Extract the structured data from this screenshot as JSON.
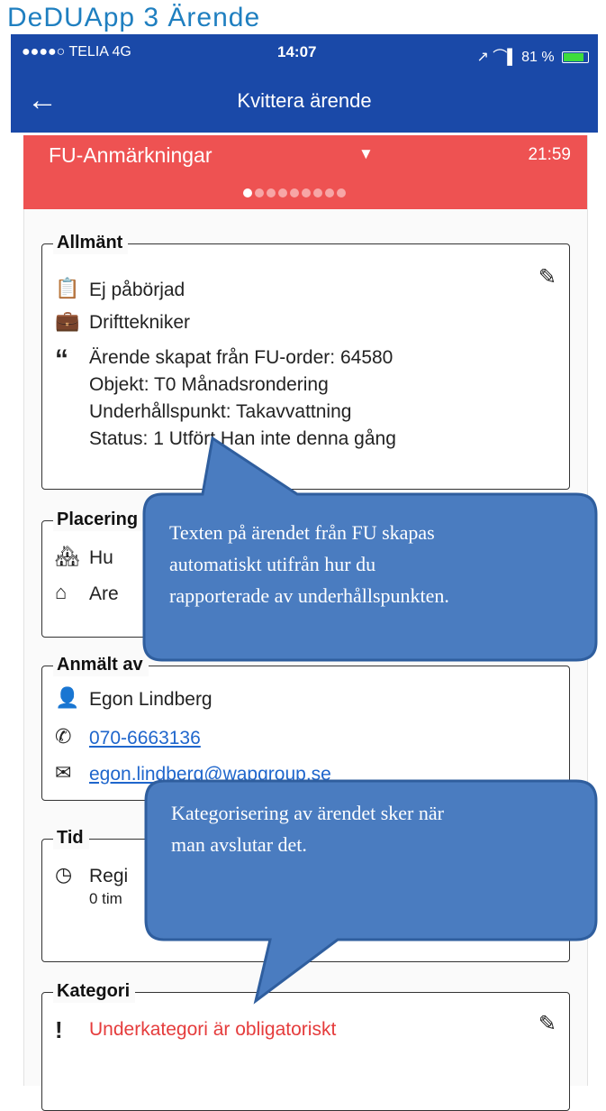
{
  "slide_title": "DeDUApp 3 Ärende",
  "status_bar": {
    "carrier": "●●●●○ TELIA  4G",
    "time": "14:07",
    "battery": "↗ ⌒▌ 81 %",
    "battery_level": 0.81
  },
  "nav": {
    "back_icon": "arrow-left-icon",
    "title": "Kvittera ärende"
  },
  "header": {
    "title": "FU-Anmärkningar",
    "caret": "▼",
    "time": "21:59",
    "pages": 9,
    "current_page": 1
  },
  "sections": {
    "allmant": {
      "legend": "Allmänt",
      "status": "Ej påbörjad",
      "role": "Drifttekniker",
      "description": [
        "Ärende skapat från FU-order: 64580",
        "Objekt: T0 Månadsrondering",
        "Underhållspunkt: Takavvattning",
        "Status: 1 Utfört Han inte denna gång"
      ]
    },
    "placering": {
      "legend": "Placering",
      "line1": "Hu",
      "line2": "Are"
    },
    "anmalt_av": {
      "legend": "Anmält av",
      "name": "Egon Lindberg",
      "phone": "070-6663136",
      "email": "egon.lindberg@wapgroup.se"
    },
    "tid": {
      "legend": "Tid",
      "line1": "Regi",
      "line2": "0 tim"
    },
    "kategori": {
      "legend": "Kategori",
      "warning": "Underkategori är obligatoriskt"
    }
  },
  "callouts": [
    {
      "text": [
        "Texten på ärendet från FU skapas",
        "automatiskt utifrån hur du",
        "rapporterade av underhållspunkten."
      ]
    },
    {
      "text": [
        "Kategorisering av ärendet sker när",
        "man avslutar det."
      ]
    }
  ],
  "colors": {
    "nav_blue": "#1a49a8",
    "header_red": "#ee5252",
    "callout_blue": "#4a7cc0",
    "link_blue": "#1f66cc",
    "warning_red": "#e53c3c"
  }
}
